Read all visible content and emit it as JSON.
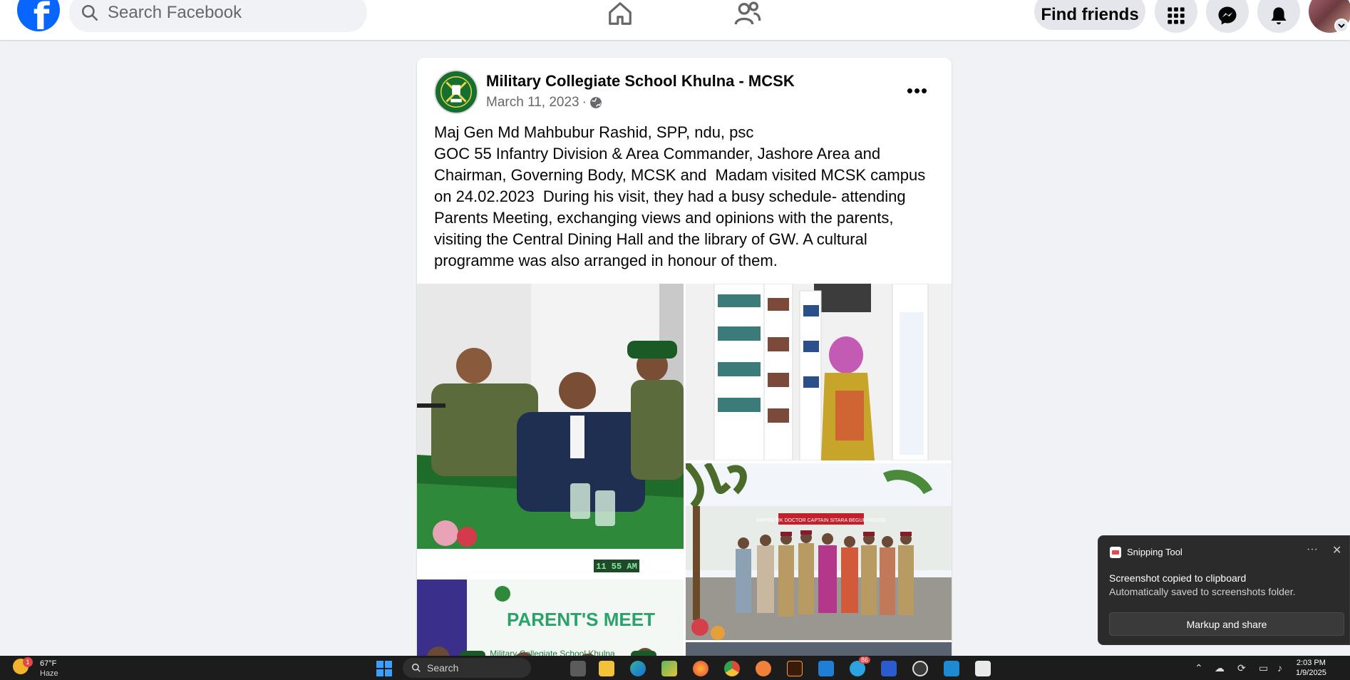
{
  "topbar": {
    "logo": "f",
    "search_placeholder": "Search Facebook",
    "find_friends": "Find friends"
  },
  "post": {
    "page_name": "Military Collegiate School Khulna - MCSK",
    "date": "March 11, 2023",
    "separator": "·",
    "more": "•••",
    "text_lines": [
      "Maj Gen Md Mahbubur Rashid, SPP, ndu, psc",
      "GOC 55 Infantry Division & Area Commander, Jashore Area and Chairman, Governing Body, MCSK and  Madam visited MCSK campus on 24.02.2023  During his visit, they had a busy schedule- attending Parents Meeting, exchanging views and opinions with the parents, visiting the Central Dining Hall and the library of GW. A cultural programme was also arranged in honour of them."
    ],
    "photo_texts": {
      "clock_sign": "11 55 AM",
      "banner": "PARENT'S MEET",
      "banner_top": "Military Collegiate School Khulna",
      "house_sign": "BIRPROTIK DOCTOR CAPTAIN SITARA BEGUM HOUSE"
    }
  },
  "toast": {
    "app_name": "Snipping Tool",
    "dots": "···",
    "close": "✕",
    "title": "Screenshot copied to clipboard",
    "subtitle": "Automatically saved to screenshots folder.",
    "button": "Markup and share"
  },
  "taskbar": {
    "weather_badge": "1",
    "temperature": "67°F",
    "condition": "Haze",
    "search": "Search",
    "telegram_badge": "86",
    "time": "2:03 PM",
    "date": "1/9/2025"
  },
  "colors": {
    "facebook_blue": "#0866ff",
    "page_bg": "#f0f2f5",
    "taskbar_bg": "#1c1c1c",
    "toast_bg": "#2b2b2b"
  }
}
